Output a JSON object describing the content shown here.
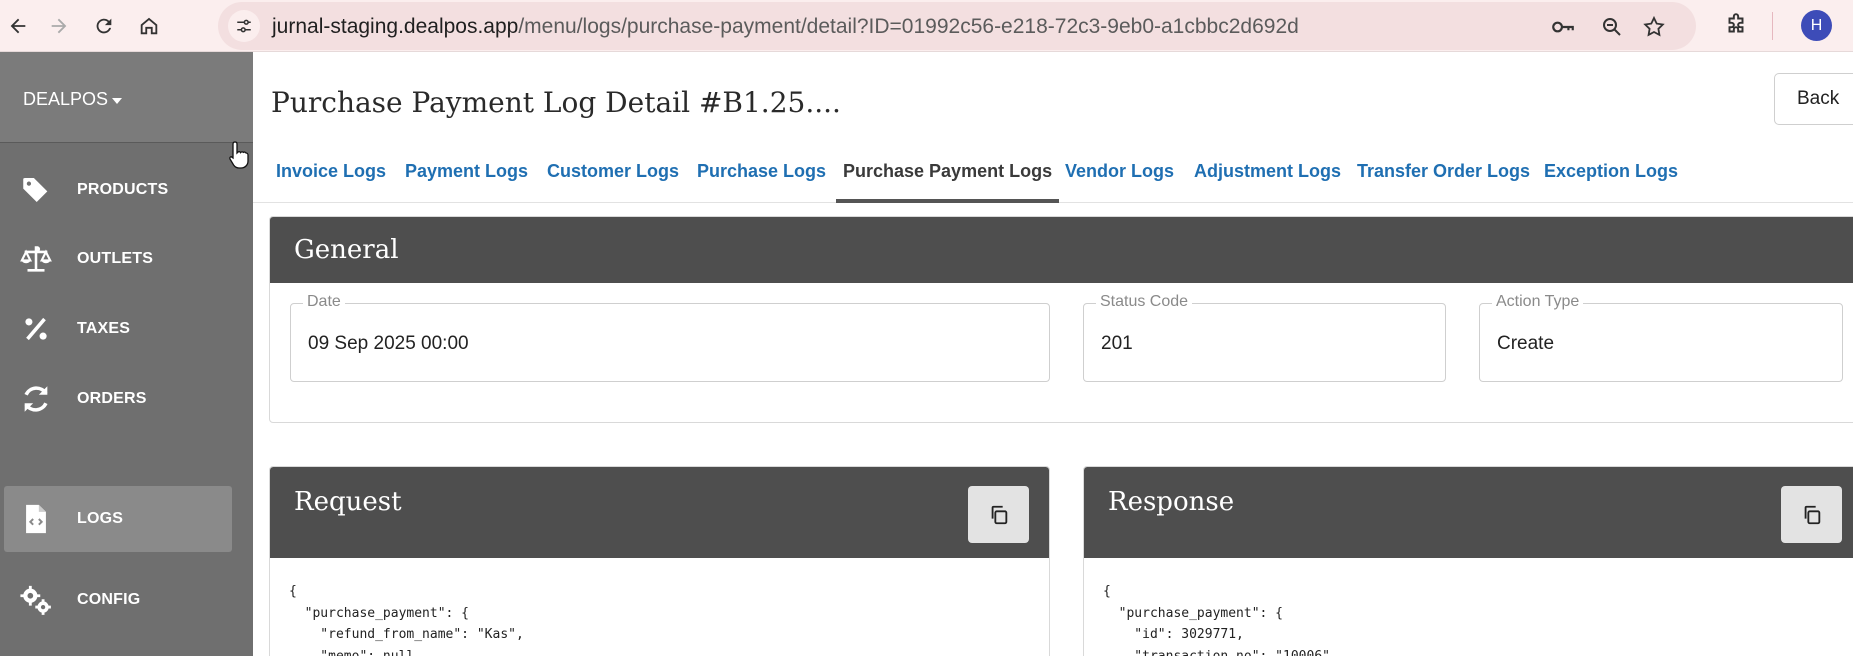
{
  "browser": {
    "url_host": "jurnal-staging.dealpos.app",
    "url_path": "/menu/logs/purchase-payment/detail?ID=01992c56-e218-72c3-9eb0-a1cbbc2d692d",
    "profile_initial": "H",
    "icons": [
      "back-arrow-icon",
      "forward-arrow-icon",
      "reload-icon",
      "home-icon",
      "site-info-icon",
      "password-key-icon",
      "zoom-icon",
      "bookmark-star-icon",
      "extensions-icon"
    ]
  },
  "sidebar": {
    "brand": "DEALPOS",
    "items": [
      {
        "label": "PRODUCTS",
        "icon": "tag-icon"
      },
      {
        "label": "OUTLETS",
        "icon": "scale-icon"
      },
      {
        "label": "TAXES",
        "icon": "percent-icon"
      },
      {
        "label": "ORDERS",
        "icon": "sync-icon"
      },
      {
        "label": "LOGS",
        "icon": "code-file-icon",
        "active": true
      },
      {
        "label": "CONFIG",
        "icon": "gears-icon"
      }
    ]
  },
  "header": {
    "title": "Purchase Payment Log Detail #B1.25....",
    "back_label": "Back"
  },
  "tabs": [
    {
      "label": "Invoice Logs"
    },
    {
      "label": "Payment Logs"
    },
    {
      "label": "Customer Logs"
    },
    {
      "label": "Purchase Logs"
    },
    {
      "label": "Purchase Payment Logs",
      "active": true
    },
    {
      "label": "Vendor Logs"
    },
    {
      "label": "Adjustment Logs"
    },
    {
      "label": "Transfer Order Logs"
    },
    {
      "label": "Exception Logs"
    }
  ],
  "general": {
    "title": "General",
    "date_label": "Date",
    "date_value": "09 Sep 2025 00:00",
    "status_label": "Status Code",
    "status_value": "201",
    "action_label": "Action Type",
    "action_value": "Create"
  },
  "request": {
    "title": "Request",
    "code": "{\n  \"purchase_payment\": {\n    \"refund_from_name\": \"Kas\",\n    \"memo\": null,"
  },
  "response": {
    "title": "Response",
    "code": "{\n  \"purchase_payment\": {\n    \"id\": 3029771,\n    \"transaction_no\": \"10006\","
  },
  "colors": {
    "sidebar_bg": "#6f6f6f",
    "panel_header_bg": "#4e4e4e",
    "tab_link": "#1f6fb2",
    "browser_bar": "#fbeeee"
  }
}
